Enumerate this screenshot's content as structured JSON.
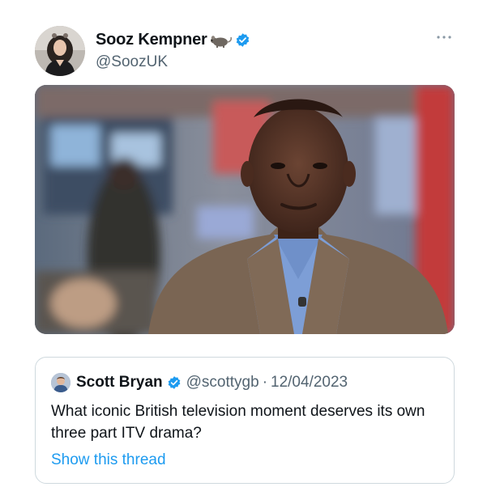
{
  "tweet": {
    "author": {
      "name": "Sooz Kempner",
      "handle": "@SoozUK",
      "avatar_icon": "profile-photo",
      "name_emoji_icon": "rat-icon",
      "verified_icon": "verified-badge-icon"
    },
    "menu_icon": "more-icon",
    "media_icon": "video-still"
  },
  "quote": {
    "author_name": "Scott Bryan",
    "handle": "@scottygb",
    "separator": "·",
    "date": "12/04/2023",
    "text": "What iconic British television moment deserves its own three part ITV drama?",
    "show_thread_label": "Show this thread"
  },
  "colors": {
    "link": "#1d9bf0",
    "verified": "#1d9bf0",
    "secondary_text": "#536471",
    "border": "#cfd9de"
  }
}
